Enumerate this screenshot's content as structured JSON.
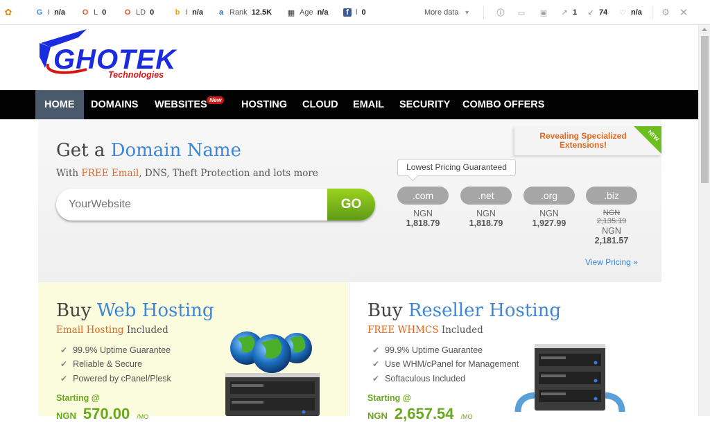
{
  "seobar": {
    "items": [
      {
        "icon": "google-icon",
        "glyph": "G",
        "label": "I",
        "value": "n/a"
      },
      {
        "icon": "links-icon",
        "glyph": "O",
        "label": "L",
        "value": "0"
      },
      {
        "icon": "linking-domains-icon",
        "glyph": "O",
        "label": "LD",
        "value": "0"
      },
      {
        "icon": "bing-icon",
        "glyph": "b",
        "label": "I",
        "value": "n/a"
      },
      {
        "icon": "alexa-icon",
        "glyph": "a",
        "label": "Rank",
        "value": "12.5K"
      },
      {
        "icon": "archive-icon",
        "glyph": "▦",
        "label": "Age",
        "value": "n/a"
      },
      {
        "icon": "facebook-icon",
        "glyph": "f",
        "label": "l",
        "value": "0"
      }
    ],
    "more_data": "More data",
    "right_items": [
      {
        "icon": "info-icon",
        "glyph": "ⓘ",
        "value": ""
      },
      {
        "icon": "page-icon",
        "glyph": "▭",
        "value": ""
      },
      {
        "icon": "image-icon",
        "glyph": "▣",
        "value": ""
      },
      {
        "icon": "external-links-icon",
        "glyph": "↗",
        "value": "1"
      },
      {
        "icon": "internal-links-icon",
        "glyph": "↙",
        "value": "74"
      },
      {
        "icon": "nofollow-icon",
        "glyph": "♡",
        "value": "n/a"
      }
    ]
  },
  "logo": {
    "brand": "GHOTEK",
    "sub": "Technologies"
  },
  "nav": {
    "items": [
      "HOME",
      "DOMAINS",
      "WEBSITES",
      "HOSTING",
      "CLOUD",
      "EMAIL",
      "SECURITY",
      "COMBO OFFERS"
    ],
    "new_badge": "New"
  },
  "domain": {
    "title_prefix": "Get a",
    "title_highlight": "Domain Name",
    "sub_prefix": "With",
    "sub_highlight": "FREE Email",
    "sub_suffix": ", DNS, Theft Protection and lots more",
    "search_placeholder": "YourWebsite",
    "go_label": "GO",
    "tooltip": "Lowest Pricing Guaranteed",
    "ribbon": "Revealing Specialized Extensions!",
    "ribbon_new": "NEW",
    "tlds": [
      {
        "ext": ".com",
        "currency": "NGN",
        "price": "1,818.79",
        "old_currency": "",
        "old_price": ""
      },
      {
        "ext": ".net",
        "currency": "NGN",
        "price": "1,818.79",
        "old_currency": "",
        "old_price": ""
      },
      {
        "ext": ".org",
        "currency": "NGN",
        "price": "1,927.99",
        "old_currency": "",
        "old_price": ""
      },
      {
        "ext": ".biz",
        "currency": "NGN",
        "price": "2,181.57",
        "old_currency": "NGN",
        "old_price": "2,135.19"
      }
    ],
    "view_pricing": "View Pricing »"
  },
  "web_hosting": {
    "title_prefix": "Buy",
    "title_highlight": "Web Hosting",
    "sub_highlight": "Email Hosting",
    "sub_suffix": " Included",
    "features": [
      "99.9% Uptime Guarantee",
      "Reliable & Secure",
      "Powered by cPanel/Plesk"
    ],
    "starting": "Starting @",
    "currency": "NGN",
    "price": "570.00",
    "per": "/MO"
  },
  "reseller_hosting": {
    "title_prefix": "Buy",
    "title_highlight": "Reseller Hosting",
    "sub_highlight": "FREE WHMCS",
    "sub_suffix": " Included",
    "features": [
      "99.9% Uptime Guarantee",
      "Use WHM/cPanel for Management",
      "Softaculous Included"
    ],
    "starting": "Starting @",
    "currency": "NGN",
    "price": "2,657.54",
    "per": "/MO"
  }
}
